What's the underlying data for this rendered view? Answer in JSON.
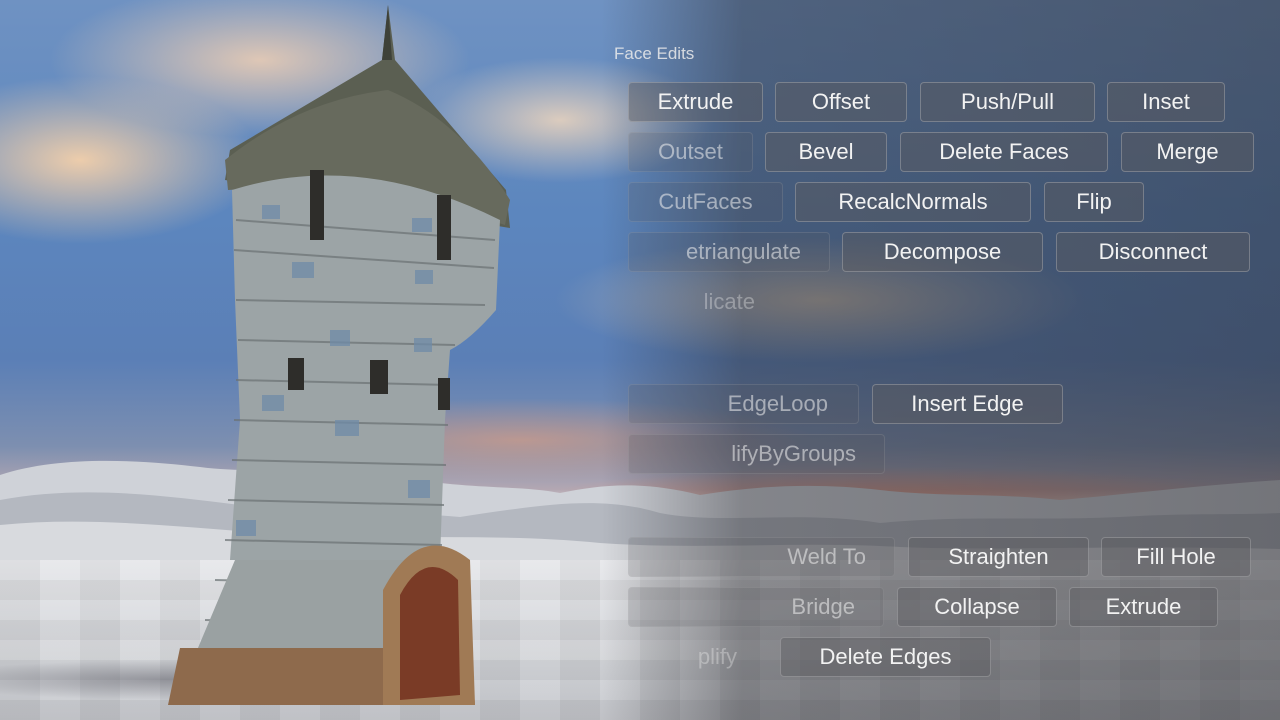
{
  "panel": {
    "title": "Face Edits"
  },
  "face_edits": [
    {
      "label": "Extrude"
    },
    {
      "label": "Offset"
    },
    {
      "label": "Push/Pull"
    },
    {
      "label": "Inset"
    },
    {
      "label": "Outset"
    },
    {
      "label": "Bevel"
    },
    {
      "label": "Delete Faces"
    },
    {
      "label": "Merge"
    },
    {
      "label": "CutFaces"
    },
    {
      "label": "RecalcNormals"
    },
    {
      "label": "Flip"
    },
    {
      "label": "etriangulate"
    },
    {
      "label": "Decompose"
    },
    {
      "label": "Disconnect"
    },
    {
      "label": "licate"
    }
  ],
  "edge_ops": [
    {
      "label": "EdgeLoop"
    },
    {
      "label": "Insert Edge"
    },
    {
      "label": "lifyByGroups"
    }
  ],
  "vertex_ops": [
    {
      "label": "Weld To"
    },
    {
      "label": "Straighten"
    },
    {
      "label": "Fill Hole"
    },
    {
      "label": "Bridge"
    },
    {
      "label": "Collapse"
    },
    {
      "label": "Extrude"
    },
    {
      "label": "plify"
    },
    {
      "label": "Delete Edges"
    }
  ],
  "colors": {
    "sky": "#5c86be",
    "button_bg": "rgba(90,90,95,0.45)",
    "button_text": "#f2f2f2"
  }
}
